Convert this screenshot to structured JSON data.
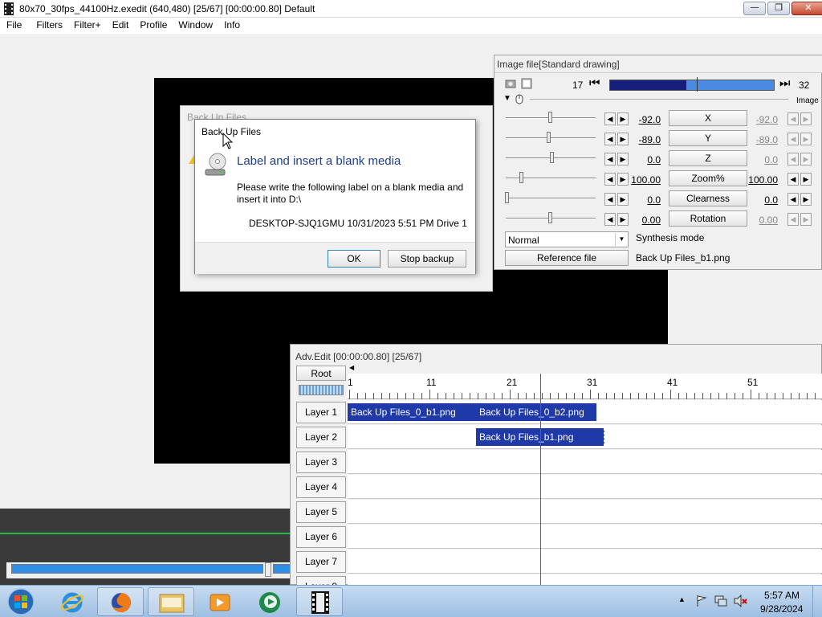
{
  "window": {
    "title": "80x70_30fps_44100Hz.exedit (640,480)  [25/67]  [00:00:00.80]  Default",
    "minimize_glyph": "—",
    "maximize_glyph": "❐",
    "close_glyph": "✕"
  },
  "menu": [
    "File",
    "Filters",
    "Filter+",
    "Edit",
    "Profile",
    "Window",
    "Info"
  ],
  "image_panel": {
    "title": "Image file[Standard drawing]",
    "frame_start": "17",
    "frame_end": "32",
    "rewind_glyph": "⏮",
    "forward_glyph": "⏭",
    "collapse_glyph": "▼",
    "clipped_label": "Image",
    "params": [
      {
        "value": "-92.0",
        "label": "X",
        "end_value": "-92.0",
        "end_gray": true,
        "thumb": 0.5
      },
      {
        "value": "-89.0",
        "label": "Y",
        "end_value": "-89.0",
        "end_gray": true,
        "thumb": 0.48
      },
      {
        "value": "0.0",
        "label": "Z",
        "end_value": "0.0",
        "end_gray": true,
        "thumb": 0.52
      },
      {
        "value": "100.00",
        "label": "Zoom%",
        "end_value": "100.00",
        "end_gray": false,
        "thumb": 0.18
      },
      {
        "value": "0.0",
        "label": "Clearness",
        "end_value": "0.0",
        "end_gray": false,
        "thumb": 0.02
      },
      {
        "value": "0.00",
        "label": "Rotation",
        "end_value": "0.00",
        "end_gray": true,
        "thumb": 0.5
      }
    ],
    "left_arrow": "◀",
    "right_arrow": "▶",
    "synthesis_value": "Normal",
    "synthesis_label": "Synthesis mode",
    "reference_button": "Reference file",
    "reference_value": "Back Up Files_b1.png"
  },
  "adv_edit": {
    "title": "Adv.Edit [00:00:00.80] [25/67]",
    "root_button": "Root",
    "ruler_ticks": [
      "1",
      "11",
      "21",
      "31",
      "41",
      "51"
    ],
    "layers": [
      "Layer 1",
      "Layer 2",
      "Layer 3",
      "Layer 4",
      "Layer 5",
      "Layer 6",
      "Layer 7",
      "Layer 8"
    ],
    "clips": [
      {
        "layer": 0,
        "label": "Back Up Files_0_b1.png",
        "start": 1,
        "end": 17
      },
      {
        "layer": 0,
        "label": "Back Up Files_0_b2.png",
        "start": 17,
        "end": 32
      },
      {
        "layer": 1,
        "label": "Back Up Files_b1.png",
        "start": 17,
        "end": 33
      }
    ],
    "cursor_frame": 25
  },
  "back_dialog": {
    "title": "Back Up Files"
  },
  "dialog": {
    "title": "Back Up Files",
    "heading": "Label and insert a blank media",
    "body": "Please write the following label on a blank media and insert it into D:\\",
    "label_text": "DESKTOP-SJQ1GMU 10/31/2023 5:51 PM Drive 1",
    "ok": "OK",
    "stop": "Stop backup"
  },
  "taskbar": {
    "time": "5:57 AM",
    "date": "9/28/2024",
    "apps": [
      "start-orb",
      "internet-explorer",
      "firefox",
      "file-explorer",
      "media-player",
      "media-center",
      "aviutl"
    ]
  }
}
